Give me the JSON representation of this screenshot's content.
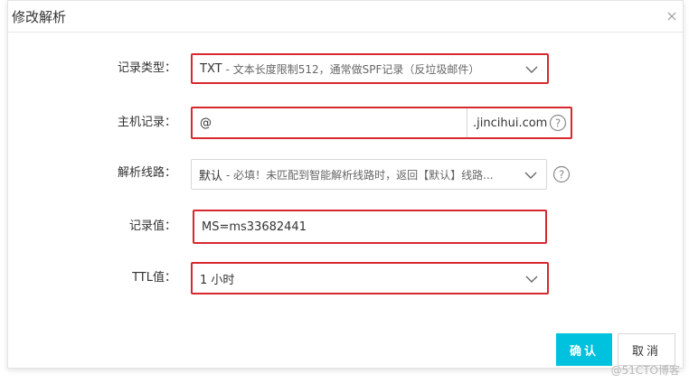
{
  "dialog": {
    "title": "修改解析"
  },
  "form": {
    "record_type": {
      "label": "记录类型：",
      "value": "TXT",
      "hint": "- 文本长度限制512，通常做SPF记录（反垃圾邮件）"
    },
    "host_record": {
      "label": "主机记录：",
      "value": "@",
      "suffix": ".jincihui.com"
    },
    "line": {
      "label": "解析线路：",
      "value": "默认",
      "hint": "- 必填！未匹配到智能解析线路时，返回【默认】线路..."
    },
    "record_value": {
      "label": "记录值：",
      "value": "MS=ms33682441"
    },
    "ttl": {
      "label": "TTL值：",
      "value": "1 小时"
    }
  },
  "buttons": {
    "confirm": "确认",
    "cancel": "取消"
  },
  "watermark": "@51CTO博客",
  "colors": {
    "accent": "#00c1de",
    "highlight": "#d7282f"
  }
}
